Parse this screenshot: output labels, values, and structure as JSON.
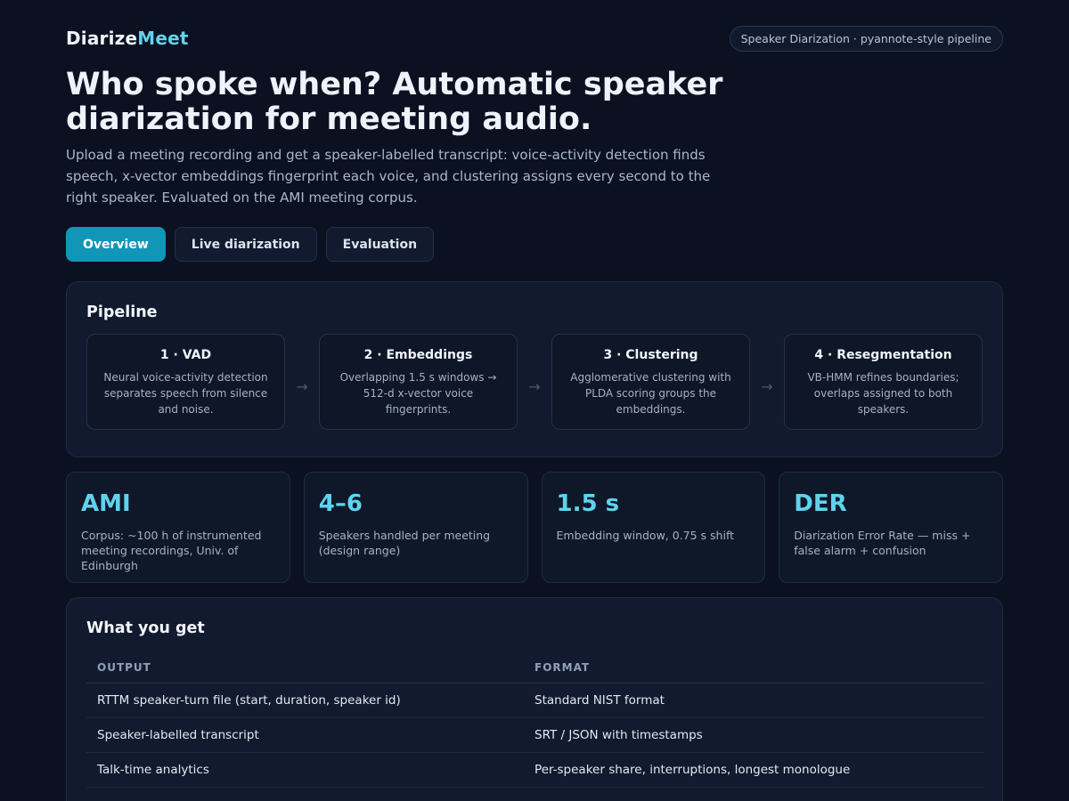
{
  "brand": {
    "name_part1": "Diarize",
    "name_part2": "Meet"
  },
  "badge": "Speaker Diarization · pyannote-style pipeline",
  "hero": {
    "title": "Who spoke when? Automatic speaker diarization for meeting audio.",
    "subtitle": "Upload a meeting recording and get a speaker-labelled transcript: voice-activity detection finds speech, x-vector embeddings fingerprint each voice, and clustering assigns every second to the right speaker. Evaluated on the AMI meeting corpus."
  },
  "tabs": [
    {
      "label": "Overview",
      "active": true
    },
    {
      "label": "Live diarization",
      "active": false
    },
    {
      "label": "Evaluation",
      "active": false
    }
  ],
  "pipeline": {
    "title": "Pipeline",
    "arrow": "→",
    "steps": [
      {
        "title": "1 · VAD",
        "desc": "Neural voice-activity detection separates speech from silence and noise."
      },
      {
        "title": "2 · Embeddings",
        "desc": "Overlapping 1.5 s windows → 512-d x-vector voice fingerprints."
      },
      {
        "title": "3 · Clustering",
        "desc": "Agglomerative clustering with PLDA scoring groups the embeddings."
      },
      {
        "title": "4 · Resegmentation",
        "desc": "VB-HMM refines boundaries; overlaps assigned to both speakers."
      }
    ]
  },
  "stats": [
    {
      "value": "AMI",
      "label": "Corpus: ~100 h of instrumented meeting recordings, Univ. of Edinburgh"
    },
    {
      "value": "4–6",
      "label": "Speakers handled per meeting (design range)"
    },
    {
      "value": "1.5 s",
      "label": "Embedding window, 0.75 s shift"
    },
    {
      "value": "DER",
      "label": "Diarization Error Rate — miss + false alarm + confusion"
    }
  ],
  "output": {
    "title": "What you get",
    "headers": [
      "OUTPUT",
      "FORMAT"
    ],
    "rows": [
      [
        "RTTM speaker-turn file (start, duration, speaker id)",
        "Standard NIST format"
      ],
      [
        "Speaker-labelled transcript",
        "SRT / JSON with timestamps"
      ],
      [
        "Talk-time analytics",
        "Per-speaker share, interruptions, longest monologue"
      ]
    ]
  },
  "colors": {
    "accent": "#5fd3ee",
    "tab_active": "#1196b8",
    "background": "#0b1120"
  }
}
